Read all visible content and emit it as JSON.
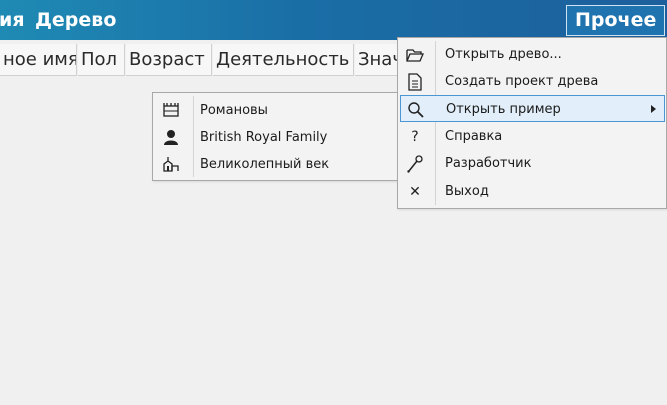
{
  "menubar": {
    "edit_partial": "ия",
    "tree": "Дерево",
    "misc": "Прочее"
  },
  "columns": [
    "ное имя",
    "Пол",
    "Возраст",
    "Деятельность",
    "Знач"
  ],
  "examples_submenu": [
    {
      "icon": "crown-icon",
      "label": "Романовы"
    },
    {
      "icon": "person-icon",
      "label": "British Royal Family"
    },
    {
      "icon": "palace-icon",
      "label": "Великолепный век"
    }
  ],
  "misc_menu": [
    {
      "icon": "folder-open-icon",
      "label": "Открыть древо..."
    },
    {
      "icon": "document-icon",
      "label": "Создать проект древа"
    },
    {
      "icon": "search-icon",
      "label": "Открыть пример"
    },
    {
      "icon": "help-icon",
      "label": "Справка",
      "glyph": "?"
    },
    {
      "icon": "wrench-icon",
      "label": "Разработчик"
    },
    {
      "icon": "close-icon",
      "label": "Выход",
      "glyph": "✕"
    }
  ]
}
